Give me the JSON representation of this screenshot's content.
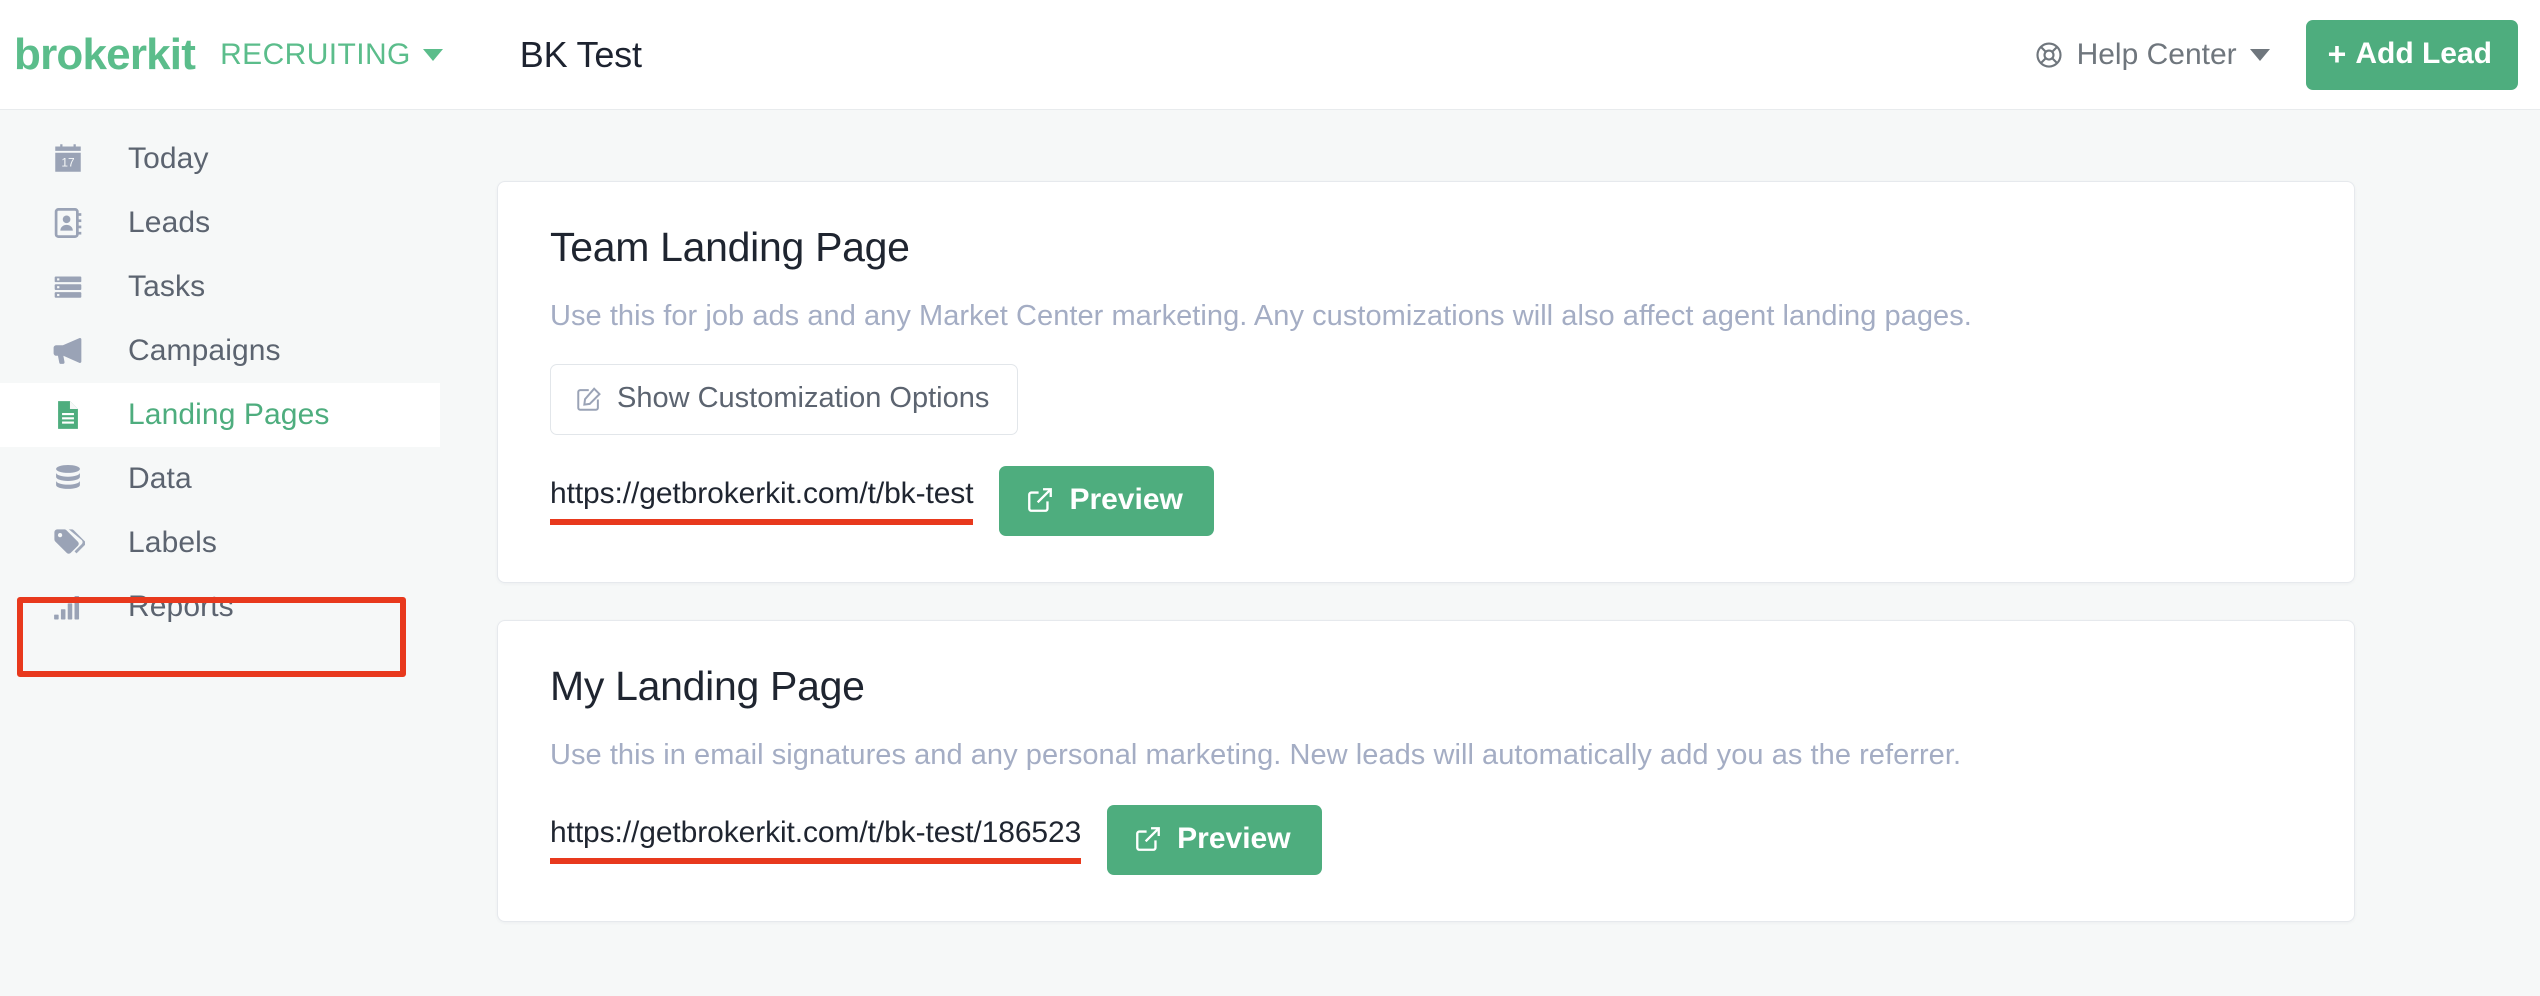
{
  "header": {
    "brand": "brokerkit",
    "mode": "RECRUITING",
    "page_title": "BK Test",
    "help_center": "Help Center",
    "add_lead": "Add Lead",
    "add_lead_plus": "+",
    "icons": {
      "help": "lifebuoy-icon",
      "mode_caret": "chevron-down-icon",
      "help_caret": "chevron-down-icon"
    },
    "colors": {
      "brand_green": "#5bbd8b",
      "button_green": "#4ead7e",
      "title_dark": "#1d2330"
    }
  },
  "sidebar": {
    "items": [
      {
        "label": "Today",
        "icon": "calendar-icon",
        "active": false
      },
      {
        "label": "Leads",
        "icon": "address-book-icon",
        "active": false
      },
      {
        "label": "Tasks",
        "icon": "task-list-icon",
        "active": false
      },
      {
        "label": "Campaigns",
        "icon": "megaphone-icon",
        "active": false
      },
      {
        "label": "Landing Pages",
        "icon": "document-icon",
        "active": true
      },
      {
        "label": "Data",
        "icon": "database-icon",
        "active": false
      },
      {
        "label": "Labels",
        "icon": "tag-icon",
        "active": false
      },
      {
        "label": "Reports",
        "icon": "bar-chart-icon",
        "active": false
      }
    ],
    "active_index": 4,
    "active_color": "#4ead7e",
    "inactive_color": "#5c6470"
  },
  "annotations": {
    "highlight_color": "#e8391d",
    "highlight_target": "Landing Pages",
    "underline_color": "#e8391d"
  },
  "main": {
    "cards": [
      {
        "title": "Team Landing Page",
        "description": "Use this for job ads and any Market Center marketing. Any customizations will also affect agent landing pages.",
        "customize_button": "Show Customization Options",
        "customize_icon": "edit-pencil-icon",
        "url": "https://getbrokerkit.com/t/bk-test",
        "preview_button": "Preview",
        "preview_icon": "external-link-icon"
      },
      {
        "title": "My Landing Page",
        "description": "Use this in email signatures and any personal marketing. New leads will automatically add you as the referrer.",
        "url": "https://getbrokerkit.com/t/bk-test/186523",
        "preview_button": "Preview",
        "preview_icon": "external-link-icon"
      }
    ]
  }
}
